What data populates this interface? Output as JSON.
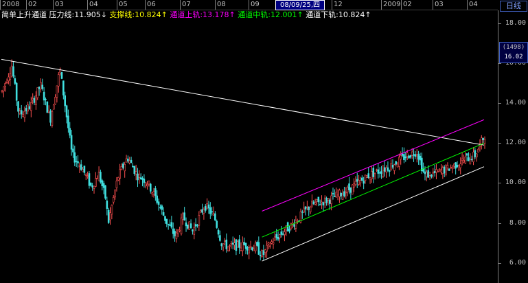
{
  "top_axis": {
    "months": [
      "2008",
      "02",
      "03",
      "04",
      "05",
      "06",
      "07",
      "08",
      "09",
      "12",
      "2009",
      "02",
      "03",
      "04"
    ],
    "cursor_date": "08/09/25,四"
  },
  "period_tab": "日线",
  "legend": {
    "indicator_name": "简单上升通道",
    "pressure_line": "压力线:11.905↓",
    "support_line": "支撑线:10.824↑",
    "channel_upper": "通道上轨:13.178↑",
    "channel_mid": "通道中轨:12.001↑",
    "channel_lower": "通道下轨:10.824↑"
  },
  "price_box": {
    "label": "(1498)",
    "value": "16.02"
  },
  "colors": {
    "up": "#ff5050",
    "down": "#40e0e0",
    "pressure": "#ffffff",
    "upper": "#ff00ff",
    "mid": "#00ff00",
    "lower": "#ffffff",
    "legend_white": "#ffffff",
    "legend_yellow": "#ffff00",
    "legend_magenta": "#ff00ff",
    "legend_green": "#00ff00"
  },
  "chart_data": {
    "type": "candlestick",
    "y_ticks": [
      "18.00",
      "16.00",
      "14.00",
      "12.00",
      "10.00",
      "8.00",
      "6.00"
    ],
    "ylim": [
      5.6,
      18.7
    ],
    "lines": {
      "pressure": [
        [
          0,
          16.2
        ],
        [
          1,
          11.905
        ]
      ],
      "upper": [
        [
          0.54,
          8.6
        ],
        [
          1,
          13.178
        ]
      ],
      "mid": [
        [
          0.54,
          7.3
        ],
        [
          1,
          12.001
        ]
      ],
      "lower": [
        [
          0.54,
          6.1
        ],
        [
          1,
          10.824
        ]
      ]
    },
    "anchors": [
      [
        0,
        14.6
      ],
      [
        0.02,
        15.9
      ],
      [
        0.035,
        13.4
      ],
      [
        0.06,
        13.9
      ],
      [
        0.08,
        14.9
      ],
      [
        0.1,
        13.2
      ],
      [
        0.12,
        15.7
      ],
      [
        0.13,
        14.0
      ],
      [
        0.145,
        11.4
      ],
      [
        0.165,
        10.8
      ],
      [
        0.185,
        9.8
      ],
      [
        0.2,
        10.5
      ],
      [
        0.215,
        9.2
      ],
      [
        0.22,
        8.0
      ],
      [
        0.24,
        10.3
      ],
      [
        0.26,
        11.3
      ],
      [
        0.28,
        10.4
      ],
      [
        0.3,
        10.1
      ],
      [
        0.32,
        9.2
      ],
      [
        0.34,
        8.1
      ],
      [
        0.36,
        7.3
      ],
      [
        0.375,
        8.3
      ],
      [
        0.395,
        7.6
      ],
      [
        0.42,
        8.9
      ],
      [
        0.44,
        8.3
      ],
      [
        0.455,
        7.0
      ],
      [
        0.47,
        6.8
      ],
      [
        0.5,
        6.9
      ],
      [
        0.525,
        6.8
      ],
      [
        0.54,
        6.4
      ],
      [
        0.56,
        7.1
      ],
      [
        0.6,
        7.9
      ],
      [
        0.64,
        8.9
      ],
      [
        0.68,
        9.2
      ],
      [
        0.72,
        9.7
      ],
      [
        0.76,
        10.4
      ],
      [
        0.8,
        10.8
      ],
      [
        0.84,
        11.4
      ],
      [
        0.86,
        11.6
      ],
      [
        0.875,
        10.4
      ],
      [
        0.9,
        10.5
      ],
      [
        0.93,
        10.8
      ],
      [
        0.96,
        11.2
      ],
      [
        0.98,
        11.4
      ],
      [
        1,
        12.4
      ]
    ]
  }
}
